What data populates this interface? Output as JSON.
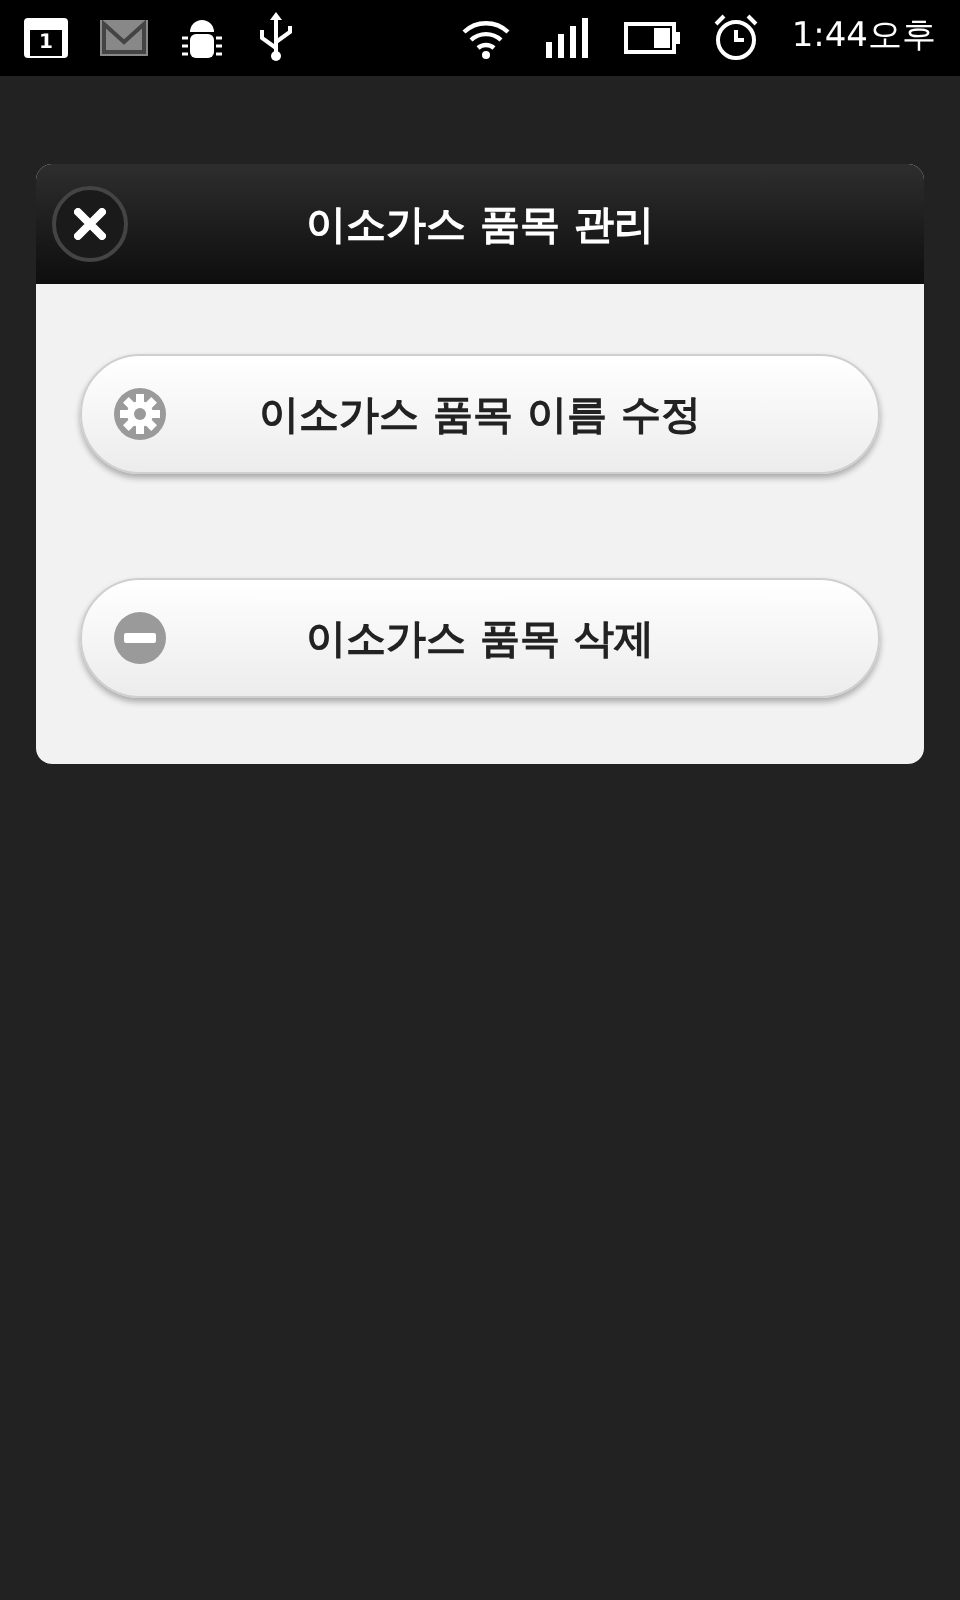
{
  "status_bar": {
    "calendar_day": "1",
    "time": "1:44오후"
  },
  "dialog": {
    "title": "이소가스 품목 관리",
    "actions": [
      {
        "kind": "edit",
        "label": "이소가스 품목 이름 수정"
      },
      {
        "kind": "delete",
        "label": "이소가스 품목 삭제"
      }
    ]
  }
}
